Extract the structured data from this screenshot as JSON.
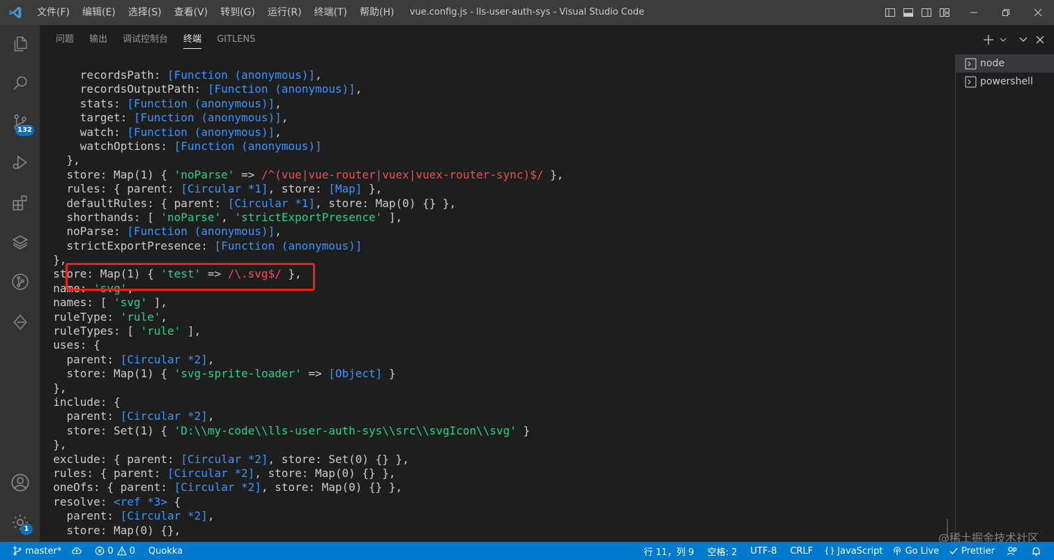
{
  "window": {
    "title": "vue.config.js - lls-user-auth-sys - Visual Studio Code",
    "logo_icon": "vscode-logo-icon"
  },
  "menu": [
    "文件(F)",
    "编辑(E)",
    "选择(S)",
    "查看(V)",
    "转到(G)",
    "运行(R)",
    "终端(T)",
    "帮助(H)"
  ],
  "activity_bar": {
    "items": [
      {
        "icon": "files-icon"
      },
      {
        "icon": "search-icon"
      },
      {
        "icon": "source-control-icon",
        "badge": "132"
      },
      {
        "icon": "run-debug-icon"
      },
      {
        "icon": "extensions-icon"
      },
      {
        "icon": "layers-icon"
      },
      {
        "icon": "git-graph-icon"
      },
      {
        "icon": "gitlens-icon"
      }
    ],
    "bottom": [
      {
        "icon": "account-icon"
      },
      {
        "icon": "settings-gear-icon",
        "badge": "1"
      }
    ]
  },
  "panel": {
    "tabs": [
      "问题",
      "输出",
      "调试控制台",
      "终端",
      "GITLENS"
    ],
    "active_tab": "终端"
  },
  "terminal": {
    "lines": [
      [
        [
          "      recordsPath: ",
          "p"
        ],
        [
          "[Function (anonymous)]",
          "f"
        ],
        [
          ",",
          "p"
        ]
      ],
      [
        [
          "      recordsOutputPath: ",
          "p"
        ],
        [
          "[Function (anonymous)]",
          "f"
        ],
        [
          ",",
          "p"
        ]
      ],
      [
        [
          "      stats: ",
          "p"
        ],
        [
          "[Function (anonymous)]",
          "f"
        ],
        [
          ",",
          "p"
        ]
      ],
      [
        [
          "      target: ",
          "p"
        ],
        [
          "[Function (anonymous)]",
          "f"
        ],
        [
          ",",
          "p"
        ]
      ],
      [
        [
          "      watch: ",
          "p"
        ],
        [
          "[Function (anonymous)]",
          "f"
        ],
        [
          ",",
          "p"
        ]
      ],
      [
        [
          "      watchOptions: ",
          "p"
        ],
        [
          "[Function (anonymous)]",
          "f"
        ]
      ],
      [
        [
          "    },",
          "p"
        ]
      ],
      [
        [
          "    store: Map(1) { ",
          "p"
        ],
        [
          "'noParse'",
          "s"
        ],
        [
          " => ",
          "p"
        ],
        [
          "/^(vue|vue-router|vuex|vuex-router-sync)$/",
          "r"
        ],
        [
          " },",
          "p"
        ]
      ],
      [
        [
          "    rules: { parent: ",
          "p"
        ],
        [
          "[Circular *1]",
          "f"
        ],
        [
          ", store: ",
          "p"
        ],
        [
          "[Map]",
          "f"
        ],
        [
          " },",
          "p"
        ]
      ],
      [
        [
          "    defaultRules: { parent: ",
          "p"
        ],
        [
          "[Circular *1]",
          "f"
        ],
        [
          ", store: Map(0) {} },",
          "p"
        ]
      ],
      [
        [
          "    shorthands: [ ",
          "p"
        ],
        [
          "'noParse'",
          "s"
        ],
        [
          ", ",
          "p"
        ],
        [
          "'strictExportPresence'",
          "s"
        ],
        [
          " ],",
          "p"
        ]
      ],
      [
        [
          "    noParse: ",
          "p"
        ],
        [
          "[Function (anonymous)]",
          "f"
        ],
        [
          ",",
          "p"
        ]
      ],
      [
        [
          "    strictExportPresence: ",
          "p"
        ],
        [
          "[Function (anonymous)]",
          "f"
        ]
      ],
      [
        [
          "  },",
          "p"
        ]
      ],
      [
        [
          "  store: Map(1) { ",
          "p"
        ],
        [
          "'test'",
          "s"
        ],
        [
          " => ",
          "p"
        ],
        [
          "/\\.svg$/",
          "r"
        ],
        [
          " },",
          "p"
        ]
      ],
      [
        [
          "  name: ",
          "p"
        ],
        [
          "'svg'",
          "s"
        ],
        [
          ",",
          "p"
        ]
      ],
      [
        [
          "  names: [ ",
          "p"
        ],
        [
          "'svg'",
          "s"
        ],
        [
          " ],",
          "p"
        ]
      ],
      [
        [
          "  ruleType: ",
          "p"
        ],
        [
          "'rule'",
          "s"
        ],
        [
          ",",
          "p"
        ]
      ],
      [
        [
          "  ruleTypes: [ ",
          "p"
        ],
        [
          "'rule'",
          "s"
        ],
        [
          " ],",
          "p"
        ]
      ],
      [
        [
          "  uses: {",
          "p"
        ]
      ],
      [
        [
          "    parent: ",
          "p"
        ],
        [
          "[Circular *2]",
          "f"
        ],
        [
          ",",
          "p"
        ]
      ],
      [
        [
          "    store: Map(1) { ",
          "p"
        ],
        [
          "'svg-sprite-loader'",
          "s"
        ],
        [
          " => ",
          "p"
        ],
        [
          "[Object]",
          "f"
        ],
        [
          " }",
          "p"
        ]
      ],
      [
        [
          "  },",
          "p"
        ]
      ],
      [
        [
          "  include: {",
          "p"
        ]
      ],
      [
        [
          "    parent: ",
          "p"
        ],
        [
          "[Circular *2]",
          "f"
        ],
        [
          ",",
          "p"
        ]
      ],
      [
        [
          "    store: Set(1) { ",
          "p"
        ],
        [
          "'D:\\\\my-code\\\\lls-user-auth-sys\\\\src\\\\svgIcon\\\\svg'",
          "s"
        ],
        [
          " }",
          "p"
        ]
      ],
      [
        [
          "  },",
          "p"
        ]
      ],
      [
        [
          "  exclude: { parent: ",
          "p"
        ],
        [
          "[Circular *2]",
          "f"
        ],
        [
          ", store: Set(0) {} },",
          "p"
        ]
      ],
      [
        [
          "  rules: { parent: ",
          "p"
        ],
        [
          "[Circular *2]",
          "f"
        ],
        [
          ", store: Map(0) {} },",
          "p"
        ]
      ],
      [
        [
          "  oneOfs: { parent: ",
          "p"
        ],
        [
          "[Circular *2]",
          "f"
        ],
        [
          ", store: Map(0) {} },",
          "p"
        ]
      ],
      [
        [
          "  resolve: ",
          "p"
        ],
        [
          "<ref *3>",
          "f"
        ],
        [
          " {",
          "p"
        ]
      ],
      [
        [
          "    parent: ",
          "p"
        ],
        [
          "[Circular *2]",
          "f"
        ],
        [
          ",",
          "p"
        ]
      ],
      [
        [
          "    store: Map(0) {},",
          "p"
        ]
      ]
    ],
    "shells": [
      {
        "label": "node",
        "icon": "terminal-icon",
        "active": true
      },
      {
        "label": "powershell",
        "icon": "terminal-icon",
        "active": false
      }
    ]
  },
  "status_bar": {
    "left": [
      {
        "icon": "git-branch-icon",
        "label": "master*"
      },
      {
        "icon": "sync-icon",
        "label": ""
      },
      {
        "icon": "error-icon",
        "label": "0"
      },
      {
        "icon": "warning-icon",
        "label": "0"
      },
      {
        "icon": "",
        "label": "Quokka"
      }
    ],
    "right": [
      {
        "icon": "",
        "label": "行 11，列 9"
      },
      {
        "icon": "",
        "label": "空格: 2"
      },
      {
        "icon": "",
        "label": "UTF-8"
      },
      {
        "icon": "",
        "label": "CRLF"
      },
      {
        "icon": "braces-icon",
        "label": "JavaScript"
      },
      {
        "icon": "broadcast-icon",
        "label": "Go Live"
      },
      {
        "icon": "check-icon",
        "label": "Prettier"
      },
      {
        "icon": "feedback-icon",
        "label": ""
      },
      {
        "icon": "bell-icon",
        "label": ""
      }
    ]
  },
  "watermark": "@稀土掘金技术社区"
}
